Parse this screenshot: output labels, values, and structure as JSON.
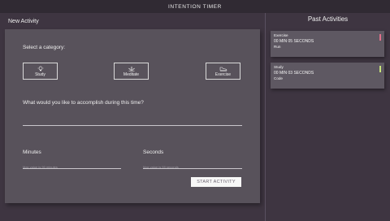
{
  "app": {
    "title": "INTENTION TIMER"
  },
  "new_activity": {
    "heading": "New Activity",
    "category_prompt": "Select a category:",
    "categories": [
      {
        "label": "Study",
        "icon": "lightbulb-icon"
      },
      {
        "label": "Meditate",
        "icon": "lotus-icon"
      },
      {
        "label": "Exercise",
        "icon": "shoe-icon"
      }
    ],
    "accomplish_prompt": "What would you like to accomplish during this time?",
    "accomplish_value": "",
    "minutes_label": "Minutes",
    "minutes_placeholder": "Max value is 90 minutes",
    "seconds_label": "Seconds",
    "seconds_placeholder": "Max value is 59 seconds",
    "start_button": "START ACTIVITY"
  },
  "past_activities": {
    "heading": "Past Activities",
    "items": [
      {
        "category": "Exercise",
        "time": "00 MIN 05 SECONDS",
        "description": "Run",
        "color": "#e0708a"
      },
      {
        "category": "Study",
        "time": "00 MIN 03 SECONDS",
        "description": "Code",
        "color": "#c6e37a"
      }
    ]
  }
}
